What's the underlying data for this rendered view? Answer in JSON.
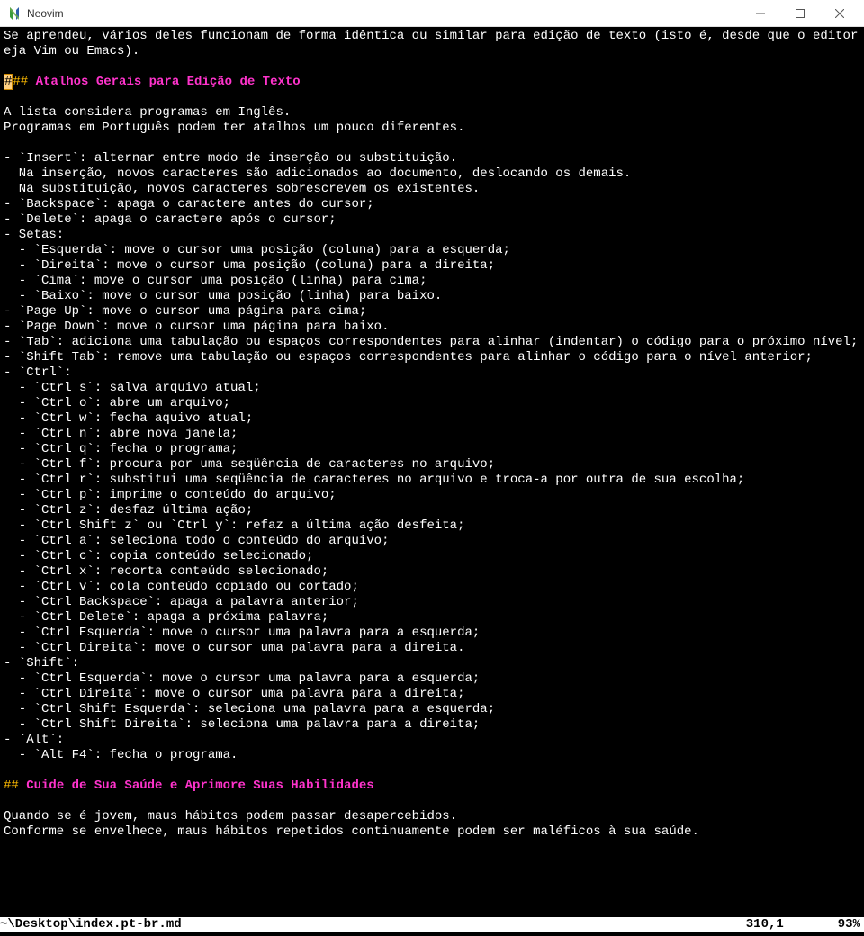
{
  "window": {
    "title": "Neovim"
  },
  "editor": {
    "lines": [
      {
        "t": "plain",
        "text": "Se aprendeu, vários deles funcionam de forma idêntica ou similar para edição de texto (isto é, desde que o editor não s"
      },
      {
        "t": "plain",
        "text": "eja Vim ou Emacs)."
      },
      {
        "t": "plain",
        "text": ""
      },
      {
        "t": "heading_cursor",
        "mark": "#",
        "rest": "## ",
        "title": "Atalhos Gerais para Edição de Texto"
      },
      {
        "t": "plain",
        "text": ""
      },
      {
        "t": "plain",
        "text": "A lista considera programas em Inglês."
      },
      {
        "t": "plain",
        "text": "Programas em Português podem ter atalhos um pouco diferentes."
      },
      {
        "t": "plain",
        "text": ""
      },
      {
        "t": "plain",
        "text": "- `Insert`: alternar entre modo de inserção ou substituição."
      },
      {
        "t": "plain",
        "text": "  Na inserção, novos caracteres são adicionados ao documento, deslocando os demais."
      },
      {
        "t": "plain",
        "text": "  Na substituição, novos caracteres sobrescrevem os existentes."
      },
      {
        "t": "plain",
        "text": "- `Backspace`: apaga o caractere antes do cursor;"
      },
      {
        "t": "plain",
        "text": "- `Delete`: apaga o caractere após o cursor;"
      },
      {
        "t": "plain",
        "text": "- Setas:"
      },
      {
        "t": "plain",
        "text": "  - `Esquerda`: move o cursor uma posição (coluna) para a esquerda;"
      },
      {
        "t": "plain",
        "text": "  - `Direita`: move o cursor uma posição (coluna) para a direita;"
      },
      {
        "t": "plain",
        "text": "  - `Cima`: move o cursor uma posição (linha) para cima;"
      },
      {
        "t": "plain",
        "text": "  - `Baixo`: move o cursor uma posição (linha) para baixo."
      },
      {
        "t": "plain",
        "text": "- `Page Up`: move o cursor uma página para cima;"
      },
      {
        "t": "plain",
        "text": "- `Page Down`: move o cursor uma página para baixo."
      },
      {
        "t": "plain",
        "text": "- `Tab`: adiciona uma tabulação ou espaços correspondentes para alinhar (indentar) o código para o próximo nível;"
      },
      {
        "t": "plain",
        "text": "- `Shift Tab`: remove uma tabulação ou espaços correspondentes para alinhar o código para o nível anterior;"
      },
      {
        "t": "plain",
        "text": "- `Ctrl`:"
      },
      {
        "t": "plain",
        "text": "  - `Ctrl s`: salva arquivo atual;"
      },
      {
        "t": "plain",
        "text": "  - `Ctrl o`: abre um arquivo;"
      },
      {
        "t": "plain",
        "text": "  - `Ctrl w`: fecha aquivo atual;"
      },
      {
        "t": "plain",
        "text": "  - `Ctrl n`: abre nova janela;"
      },
      {
        "t": "plain",
        "text": "  - `Ctrl q`: fecha o programa;"
      },
      {
        "t": "plain",
        "text": "  - `Ctrl f`: procura por uma seqüência de caracteres no arquivo;"
      },
      {
        "t": "plain",
        "text": "  - `Ctrl r`: substitui uma seqüência de caracteres no arquivo e troca-a por outra de sua escolha;"
      },
      {
        "t": "plain",
        "text": "  - `Ctrl p`: imprime o conteúdo do arquivo;"
      },
      {
        "t": "plain",
        "text": "  - `Ctrl z`: desfaz última ação;"
      },
      {
        "t": "plain",
        "text": "  - `Ctrl Shift z` ou `Ctrl y`: refaz a última ação desfeita;"
      },
      {
        "t": "plain",
        "text": "  - `Ctrl a`: seleciona todo o conteúdo do arquivo;"
      },
      {
        "t": "plain",
        "text": "  - `Ctrl c`: copia conteúdo selecionado;"
      },
      {
        "t": "plain",
        "text": "  - `Ctrl x`: recorta conteúdo selecionado;"
      },
      {
        "t": "plain",
        "text": "  - `Ctrl v`: cola conteúdo copiado ou cortado;"
      },
      {
        "t": "plain",
        "text": "  - `Ctrl Backspace`: apaga a palavra anterior;"
      },
      {
        "t": "plain",
        "text": "  - `Ctrl Delete`: apaga a próxima palavra;"
      },
      {
        "t": "plain",
        "text": "  - `Ctrl Esquerda`: move o cursor uma palavra para a esquerda;"
      },
      {
        "t": "plain",
        "text": "  - `Ctrl Direita`: move o cursor uma palavra para a direita."
      },
      {
        "t": "plain",
        "text": "- `Shift`:"
      },
      {
        "t": "plain",
        "text": "  - `Ctrl Esquerda`: move o cursor uma palavra para a esquerda;"
      },
      {
        "t": "plain",
        "text": "  - `Ctrl Direita`: move o cursor uma palavra para a direita;"
      },
      {
        "t": "plain",
        "text": "  - `Ctrl Shift Esquerda`: seleciona uma palavra para a esquerda;"
      },
      {
        "t": "plain",
        "text": "  - `Ctrl Shift Direita`: seleciona uma palavra para a direita;"
      },
      {
        "t": "plain",
        "text": "- `Alt`:"
      },
      {
        "t": "plain",
        "text": "  - `Alt F4`: fecha o programa."
      },
      {
        "t": "plain",
        "text": ""
      },
      {
        "t": "heading",
        "mark": "## ",
        "title": "Cuide de Sua Saúde e Aprimore Suas Habilidades"
      },
      {
        "t": "plain",
        "text": ""
      },
      {
        "t": "plain",
        "text": "Quando se é jovem, maus hábitos podem passar desapercebidos."
      },
      {
        "t": "plain",
        "text": "Conforme se envelhece, maus hábitos repetidos continuamente podem ser maléficos à sua saúde."
      },
      {
        "t": "plain",
        "text": ""
      }
    ]
  },
  "status": {
    "file": "~\\Desktop\\index.pt-br.md",
    "position": "310,1",
    "percent": "93%"
  }
}
